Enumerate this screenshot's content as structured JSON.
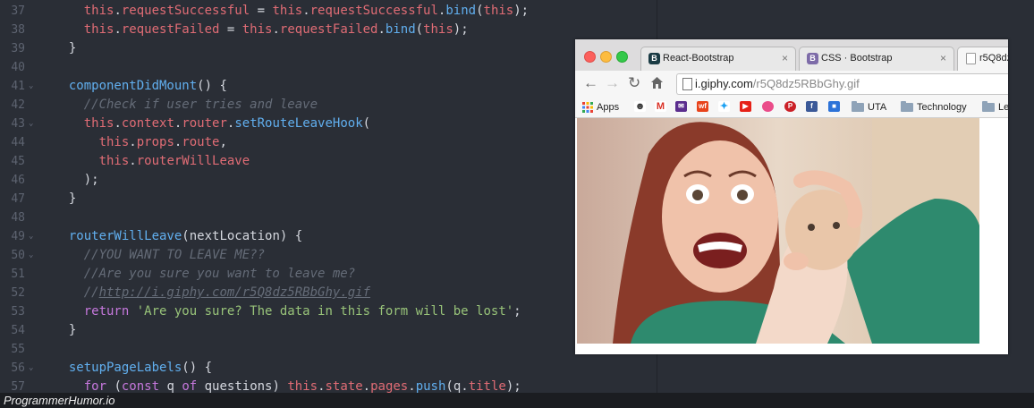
{
  "editor": {
    "lines": [
      {
        "n": "37",
        "fold": false,
        "tokens": [
          [
            "pl",
            "    "
          ],
          [
            "this",
            "this"
          ],
          [
            "pl",
            "."
          ],
          [
            "prop",
            "requestSuccessful"
          ],
          [
            "pl",
            " = "
          ],
          [
            "this",
            "this"
          ],
          [
            "pl",
            "."
          ],
          [
            "prop",
            "requestSuccessful"
          ],
          [
            "pl",
            "."
          ],
          [
            "fn",
            "bind"
          ],
          [
            "pl",
            "("
          ],
          [
            "this",
            "this"
          ],
          [
            "pl",
            ");"
          ]
        ]
      },
      {
        "n": "38",
        "fold": false,
        "tokens": [
          [
            "pl",
            "    "
          ],
          [
            "this",
            "this"
          ],
          [
            "pl",
            "."
          ],
          [
            "prop",
            "requestFailed"
          ],
          [
            "pl",
            " = "
          ],
          [
            "this",
            "this"
          ],
          [
            "pl",
            "."
          ],
          [
            "prop",
            "requestFailed"
          ],
          [
            "pl",
            "."
          ],
          [
            "fn",
            "bind"
          ],
          [
            "pl",
            "("
          ],
          [
            "this",
            "this"
          ],
          [
            "pl",
            ");"
          ]
        ]
      },
      {
        "n": "39",
        "fold": false,
        "tokens": [
          [
            "pl",
            "  }"
          ]
        ]
      },
      {
        "n": "40",
        "fold": false,
        "tokens": []
      },
      {
        "n": "41",
        "fold": true,
        "tokens": [
          [
            "pl",
            "  "
          ],
          [
            "fn",
            "componentDidMount"
          ],
          [
            "pl",
            "() {"
          ]
        ]
      },
      {
        "n": "42",
        "fold": false,
        "tokens": [
          [
            "pl",
            "    "
          ],
          [
            "cm",
            "//Check if user tries and leave"
          ]
        ]
      },
      {
        "n": "43",
        "fold": true,
        "tokens": [
          [
            "pl",
            "    "
          ],
          [
            "this",
            "this"
          ],
          [
            "pl",
            "."
          ],
          [
            "prop",
            "context"
          ],
          [
            "pl",
            "."
          ],
          [
            "prop",
            "router"
          ],
          [
            "pl",
            "."
          ],
          [
            "fn",
            "setRouteLeaveHook"
          ],
          [
            "pl",
            "("
          ]
        ]
      },
      {
        "n": "44",
        "fold": false,
        "tokens": [
          [
            "pl",
            "      "
          ],
          [
            "this",
            "this"
          ],
          [
            "pl",
            "."
          ],
          [
            "prop",
            "props"
          ],
          [
            "pl",
            "."
          ],
          [
            "prop",
            "route"
          ],
          [
            "pl",
            ","
          ]
        ]
      },
      {
        "n": "45",
        "fold": false,
        "tokens": [
          [
            "pl",
            "      "
          ],
          [
            "this",
            "this"
          ],
          [
            "pl",
            "."
          ],
          [
            "prop",
            "routerWillLeave"
          ]
        ]
      },
      {
        "n": "46",
        "fold": false,
        "tokens": [
          [
            "pl",
            "    );"
          ]
        ]
      },
      {
        "n": "47",
        "fold": false,
        "tokens": [
          [
            "pl",
            "  }"
          ]
        ]
      },
      {
        "n": "48",
        "fold": false,
        "tokens": []
      },
      {
        "n": "49",
        "fold": true,
        "tokens": [
          [
            "pl",
            "  "
          ],
          [
            "fn",
            "routerWillLeave"
          ],
          [
            "pl",
            "(nextLocation) {"
          ]
        ]
      },
      {
        "n": "50",
        "fold": true,
        "tokens": [
          [
            "pl",
            "    "
          ],
          [
            "cm",
            "//YOU WANT TO LEAVE ME??"
          ]
        ]
      },
      {
        "n": "51",
        "fold": false,
        "tokens": [
          [
            "pl",
            "    "
          ],
          [
            "cm",
            "//Are you sure you want to leave me?"
          ]
        ]
      },
      {
        "n": "52",
        "fold": false,
        "tokens": [
          [
            "pl",
            "    "
          ],
          [
            "cm",
            "//"
          ],
          [
            "cmu",
            "http://i.giphy.com/r5Q8dz5RBbGhy.gif"
          ]
        ]
      },
      {
        "n": "53",
        "fold": false,
        "tokens": [
          [
            "pl",
            "    "
          ],
          [
            "kw",
            "return"
          ],
          [
            "pl",
            " "
          ],
          [
            "str",
            "'Are you sure? The data in this form will be lost'"
          ],
          [
            "pl",
            ";"
          ]
        ]
      },
      {
        "n": "54",
        "fold": false,
        "tokens": [
          [
            "pl",
            "  }"
          ]
        ]
      },
      {
        "n": "55",
        "fold": false,
        "tokens": []
      },
      {
        "n": "56",
        "fold": true,
        "tokens": [
          [
            "pl",
            "  "
          ],
          [
            "fn",
            "setupPageLabels"
          ],
          [
            "pl",
            "() {"
          ]
        ]
      },
      {
        "n": "57",
        "fold": false,
        "tokens": [
          [
            "pl",
            "    "
          ],
          [
            "kw",
            "for"
          ],
          [
            "pl",
            " ("
          ],
          [
            "kw",
            "const"
          ],
          [
            "pl",
            " q "
          ],
          [
            "kw",
            "of"
          ],
          [
            "pl",
            " questions) "
          ],
          [
            "this",
            "this"
          ],
          [
            "pl",
            "."
          ],
          [
            "prop",
            "state"
          ],
          [
            "pl",
            "."
          ],
          [
            "prop",
            "pages"
          ],
          [
            "pl",
            "."
          ],
          [
            "fn",
            "push"
          ],
          [
            "pl",
            "(q."
          ],
          [
            "prop",
            "title"
          ],
          [
            "pl",
            ");"
          ]
        ]
      }
    ]
  },
  "browser": {
    "tabs": [
      {
        "label": "React-Bootstrap",
        "icon": "react-bootstrap-icon",
        "icon_glyph": "B",
        "icon_color": "#1a3b44",
        "close": "×"
      },
      {
        "label": "CSS · Bootstrap",
        "icon": "bootstrap-icon",
        "icon_glyph": "B",
        "icon_color": "#7d6ba8",
        "close": "×"
      },
      {
        "label": "r5Q8dz",
        "icon": "page-icon",
        "icon_glyph": "",
        "icon_color": "#ffffff",
        "close": ""
      }
    ],
    "address": {
      "host": "i.giphy.com",
      "path": "/r5Q8dz5RBbGhy.gif"
    },
    "bookmarks": [
      {
        "label": "Apps",
        "icon": "apps-grid-icon"
      },
      {
        "label": "",
        "icon": "reddit-icon"
      },
      {
        "label": "",
        "icon": "gmail-icon"
      },
      {
        "label": "",
        "icon": "mail-icon"
      },
      {
        "label": "",
        "icon": "wf-icon"
      },
      {
        "label": "",
        "icon": "twitter-icon"
      },
      {
        "label": "",
        "icon": "youtube-icon"
      },
      {
        "label": "",
        "icon": "dribbble-icon"
      },
      {
        "label": "",
        "icon": "pinterest-icon"
      },
      {
        "label": "",
        "icon": "facebook-icon"
      },
      {
        "label": "",
        "icon": "app-icon"
      },
      {
        "label": "UTA",
        "icon": "folder-icon"
      },
      {
        "label": "Technology",
        "icon": "folder-icon"
      },
      {
        "label": "Le",
        "icon": "folder-icon"
      }
    ],
    "colors": {
      "close": "#fc605c",
      "minimize": "#fdbc40",
      "zoom": "#34c84a"
    }
  },
  "footer": {
    "watermark": "ProgrammerHumor.io"
  }
}
